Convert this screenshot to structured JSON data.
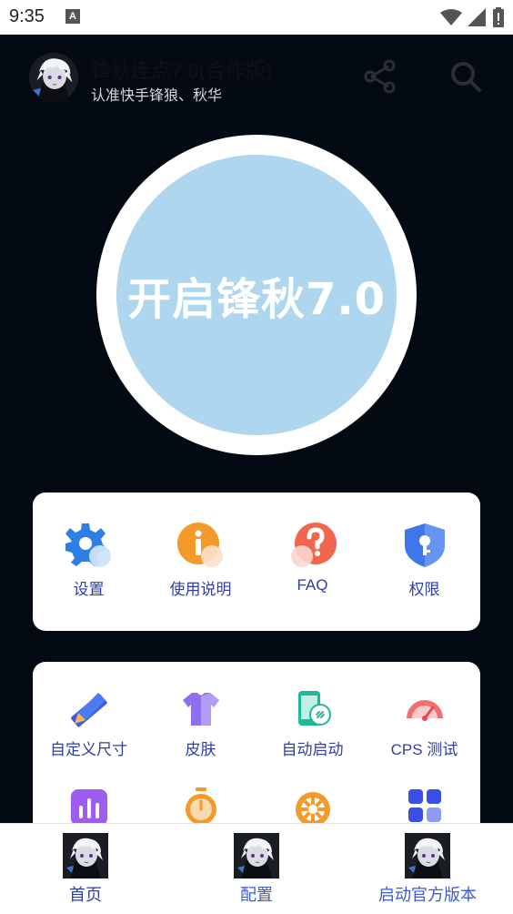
{
  "status_bar": {
    "time": "9:35",
    "notification_icon": "a-icon",
    "icons": [
      "wifi-icon",
      "signal-icon",
      "battery-icon"
    ]
  },
  "header": {
    "title": "锋秋连点7.0(合作版)",
    "subtitle": "认准快手锋狼、秋华",
    "icons": [
      "share-icon",
      "search-icon"
    ]
  },
  "main_button": {
    "label": "开启锋秋7.0"
  },
  "card1": {
    "items": [
      {
        "label": "设置",
        "icon": "gear-icon"
      },
      {
        "label": "使用说明",
        "icon": "info-icon"
      },
      {
        "label": "FAQ",
        "icon": "question-icon"
      },
      {
        "label": "权限",
        "icon": "shield-key-icon"
      }
    ]
  },
  "card2": {
    "items": [
      {
        "label": "自定义尺寸",
        "icon": "ruler-pencil-icon"
      },
      {
        "label": "皮肤",
        "icon": "shirt-icon"
      },
      {
        "label": "自动启动",
        "icon": "phone-link-icon"
      },
      {
        "label": "CPS 测试",
        "icon": "speedometer-icon"
      },
      {
        "label": "",
        "icon": "bar-chart-icon"
      },
      {
        "label": "",
        "icon": "stopwatch-icon"
      },
      {
        "label": "",
        "icon": "wheel-icon"
      },
      {
        "label": "",
        "icon": "apps-grid-icon"
      }
    ]
  },
  "bottom_nav": {
    "items": [
      {
        "label": "首页",
        "active": true
      },
      {
        "label": "配置",
        "active": false
      },
      {
        "label": "启动官方版本",
        "active": false
      }
    ]
  },
  "colors": {
    "background_dark": "#040a14",
    "circle_fill": "#aed6ef",
    "label_blue": "#2f3da8"
  }
}
